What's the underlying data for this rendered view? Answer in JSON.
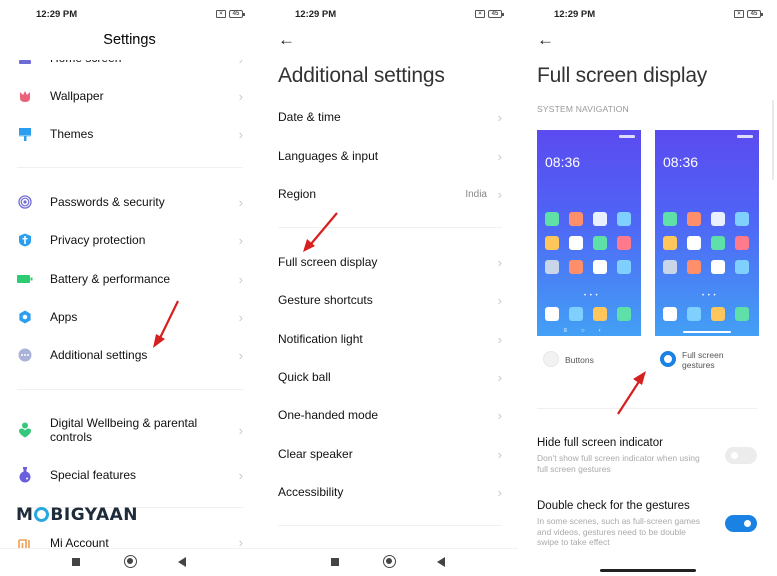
{
  "status_bar": {
    "time": "12:29 PM",
    "sim_icon": "sim-card-icon",
    "battery": "45"
  },
  "panel1": {
    "title": "Settings",
    "partial_item": "Home screen",
    "items": [
      {
        "label": "Wallpaper",
        "icon": "wallpaper-tulip-icon",
        "color": "#e8637a"
      },
      {
        "label": "Themes",
        "icon": "themes-brush-icon",
        "color": "#2c9ef0"
      },
      {
        "label": "Passwords & security",
        "icon": "fingerprint-icon",
        "color": "#6f6bd6"
      },
      {
        "label": "Privacy protection",
        "icon": "privacy-shield-icon",
        "color": "#2c9ef0"
      },
      {
        "label": "Battery & performance",
        "icon": "battery-icon",
        "color": "#2ecc71"
      },
      {
        "label": "Apps",
        "icon": "gear-icon",
        "color": "#2c9ef0"
      },
      {
        "label": "Additional settings",
        "icon": "more-dots-icon",
        "color": "#a9b3d9"
      },
      {
        "label": "Digital Wellbeing & parental controls",
        "icon": "wellbeing-heart-icon",
        "color": "#34c87a"
      },
      {
        "label": "Special features",
        "icon": "flask-icon",
        "color": "#6a5ee0"
      },
      {
        "label": "Mi Account",
        "icon": "mi-logo-icon",
        "color": "#f0a050"
      }
    ],
    "watermark": {
      "before": "M",
      "after": "BIGYAAN"
    }
  },
  "panel2": {
    "title": "Additional settings",
    "group1": [
      {
        "label": "Date & time"
      },
      {
        "label": "Languages & input"
      },
      {
        "label": "Region",
        "value": "India"
      }
    ],
    "group2": [
      {
        "label": "Full screen display"
      },
      {
        "label": "Gesture shortcuts"
      },
      {
        "label": "Notification light"
      },
      {
        "label": "Quick ball"
      },
      {
        "label": "One-handed mode"
      },
      {
        "label": "Clear speaker"
      },
      {
        "label": "Accessibility"
      }
    ]
  },
  "panel3": {
    "title": "Full screen display",
    "section_label": "SYSTEM NAVIGATION",
    "preview_time": "08:36",
    "options": [
      {
        "label": "Buttons",
        "selected": false
      },
      {
        "label": "Full screen gestures",
        "selected": true
      }
    ],
    "settings": [
      {
        "title": "Hide full screen indicator",
        "desc": "Don't show full screen indicator when using full screen gestures",
        "enabled": false
      },
      {
        "title": "Double check for the gestures",
        "desc": "In some scenes, such as full-screen games and videos, gestures need to be double swipe to take effect",
        "enabled": true
      }
    ]
  },
  "colors": {
    "accent": "#1a82e2",
    "arrow": "#d62020",
    "app_icons": [
      "#5ee0a8",
      "#ff8f6b",
      "#e9f0ff",
      "#7fd0ff",
      "#ffc65c",
      "#ffffff",
      "#5ee0a8",
      "#ff7a8a",
      "#c9d6ea",
      "#ff8f6b",
      "#ffffff",
      "#7fd0ff"
    ],
    "dock_icons": [
      "#ffffff",
      "#7fd0ff",
      "#ffc65c",
      "#5ee0a8"
    ]
  }
}
